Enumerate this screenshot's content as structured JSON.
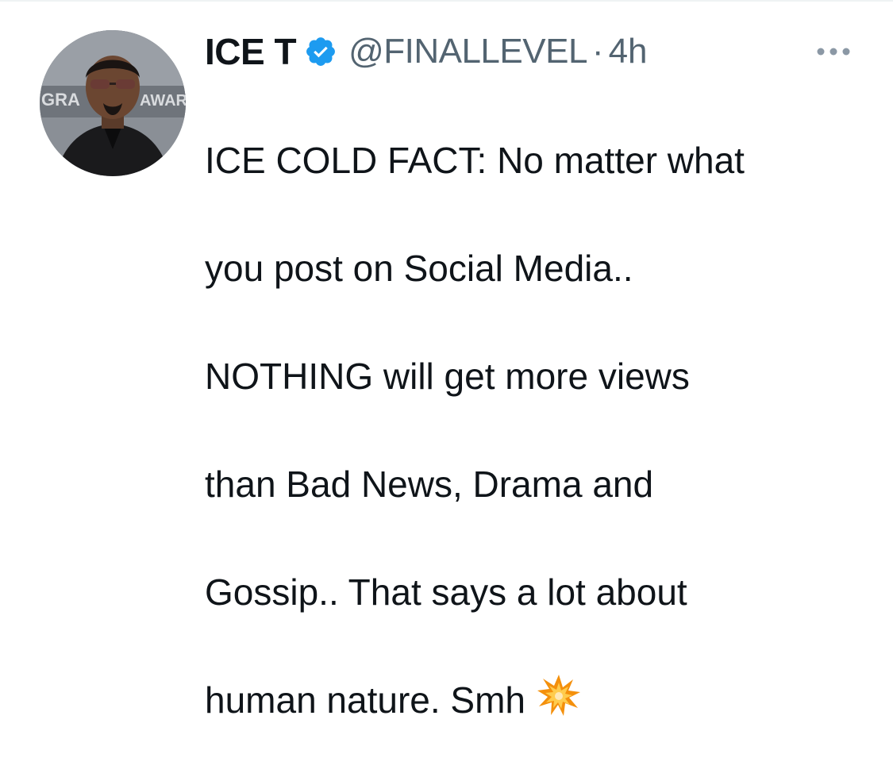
{
  "tweet": {
    "author": {
      "display_name": "ICE T",
      "handle": "@FINALLEVEL",
      "verified_icon": "verified-badge-icon",
      "avatar_icon": "avatar"
    },
    "separator": "·",
    "time": "4h",
    "more_icon": "more-options-icon",
    "text_lines": [
      "ICE COLD FACT: No matter what",
      "you post on Social Media..",
      "NOTHING will get more views",
      "than Bad News, Drama and",
      "Gossip.. That says a lot about",
      "human nature. Smh"
    ],
    "trailing_emoji": "collision-emoji-icon",
    "avatar_backdrop_text": {
      "left": "GRA",
      "right": "AWARD"
    }
  },
  "colors": {
    "text_primary": "#0f1419",
    "text_secondary": "#536471",
    "verified_blue": "#1d9bf0",
    "divider": "#eff3f4"
  }
}
